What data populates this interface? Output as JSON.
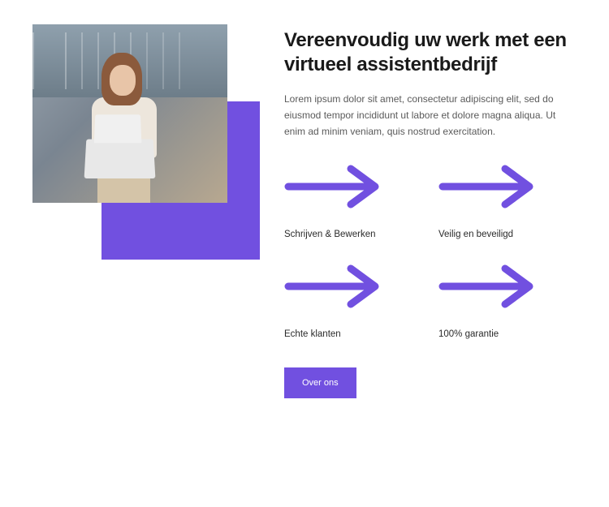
{
  "heading": "Vereenvoudig uw werk met een virtueel assistentbedrijf",
  "body": "Lorem ipsum dolor sit amet, consectetur adipiscing elit, sed do eiusmod tempor incididunt ut labore et dolore magna aliqua. Ut enim ad minim veniam, quis nostrud exercitation.",
  "features": [
    {
      "label": "Schrijven & Bewerken"
    },
    {
      "label": "Veilig en beveiligd"
    },
    {
      "label": "Echte klanten"
    },
    {
      "label": "100% garantie"
    }
  ],
  "cta": {
    "label": "Over ons"
  },
  "colors": {
    "accent": "#7150e0"
  }
}
